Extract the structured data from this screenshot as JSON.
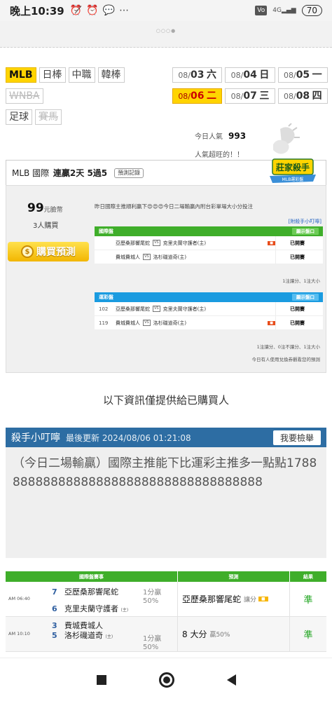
{
  "status": {
    "time": "晚上10:39",
    "icons": [
      "alarm-off-icon",
      "alarm-icon",
      "chat-icon",
      "more-icon"
    ],
    "network": "4G",
    "battery": "70"
  },
  "categories": {
    "row1": [
      "MLB",
      "日棒",
      "中職",
      "韓棒"
    ],
    "row2": [
      "WNBA"
    ],
    "row3": [
      "足球",
      "賽馬"
    ],
    "active": "MLB"
  },
  "dates": [
    {
      "prefix": "08/",
      "day": "03",
      "weekday": "六"
    },
    {
      "prefix": "08/",
      "day": "04",
      "weekday": "日"
    },
    {
      "prefix": "08/",
      "day": "05",
      "weekday": "一"
    },
    {
      "prefix": "08/",
      "day": "06",
      "weekday": "二"
    },
    {
      "prefix": "08/",
      "day": "07",
      "weekday": "三"
    },
    {
      "prefix": "08/",
      "day": "08",
      "weekday": "四"
    }
  ],
  "popularity": {
    "label": "今日人氣",
    "value": "993",
    "subtitle": "人氣超旺的！！"
  },
  "mlb_header": {
    "league": "MLB 國際",
    "streak": "連贏2天 5過5",
    "record_btn": "預測記錄",
    "badge": "莊家殺手",
    "badge_sub": "MLB運彩盤"
  },
  "panel": {
    "price_value": "99",
    "price_unit": "元臉幣",
    "buyers": "3人購買",
    "buy_button": "購買預測",
    "intro": "昨日國際主推順利贏下😍😍😍今日二場輸贏內附台彩單場大小分投注",
    "tip_link": "[附殺手小叮嚀]",
    "intl_table": {
      "title": "國際盤",
      "display_btn": "顯示盤口",
      "rows": [
        {
          "away": "亞歷桑那響尾蛇",
          "home": "克里夫蘭守護者(主)",
          "tag": "",
          "status": "已開賽"
        },
        {
          "away": "費城費城人",
          "home": "洛杉磯道奇(主)",
          "tag": "",
          "status": "已開賽"
        }
      ],
      "note": "1注讓分、1注大小"
    },
    "sports_table": {
      "title": "運彩盤",
      "display_btn": "顯示盤口",
      "rows": [
        {
          "num": "102",
          "away": "亞歷桑那響尾蛇",
          "home": "克里夫蘭守護者(主)",
          "tag": "",
          "status": "已開賽"
        },
        {
          "num": "119",
          "away": "費城費城人",
          "home": "洛杉磯道奇(主)",
          "tag": "",
          "status": "已開賽"
        }
      ],
      "note": "1注讓分、0注不讓分、1注大小",
      "note2": "今日有人使用兌換券觀看您的預測"
    }
  },
  "info_line": "以下資訊僅提供給已購買人",
  "tip": {
    "title": "殺手小叮嚀",
    "updated": "最後更新 2024/08/06 01:21:08",
    "report_btn": "我要檢舉",
    "body": "（今日二場輸贏）國際主推能下比運彩主推多一點點1788888888888888888888888888888888888"
  },
  "results_table": {
    "headers": [
      "國際盤賽事",
      "預測",
      "結果"
    ],
    "rows": [
      {
        "time": "AM 06:40",
        "team1_num": "7",
        "team1": "亞歷桑那響尾蛇",
        "team1_suffix": "",
        "team2_num": "6",
        "team2": "克里夫蘭守護者",
        "team2_suffix": "(主)",
        "odds": "1分贏\n50%",
        "prediction": "亞歷桑那響尾蛇",
        "pred_extra": "讓分",
        "pred_tag": "",
        "result": "準"
      },
      {
        "time": "AM 10:10",
        "team1_num": "3",
        "team1": "費城費城人",
        "team1_suffix": "",
        "team2_num": "5",
        "team2": "洛杉磯道奇",
        "team2_suffix": "(主)",
        "odds": "1分贏\n50%",
        "prediction": "8 大分",
        "pred_extra": "贏50%",
        "pred_tag": "",
        "result": "準"
      }
    ]
  },
  "colors": {
    "accent_yellow": "#ffd400",
    "tip_blue": "#2d6da3",
    "table_green": "#3fae2a",
    "table_blue": "#1a9be0",
    "result_green": "#1aa31a"
  }
}
